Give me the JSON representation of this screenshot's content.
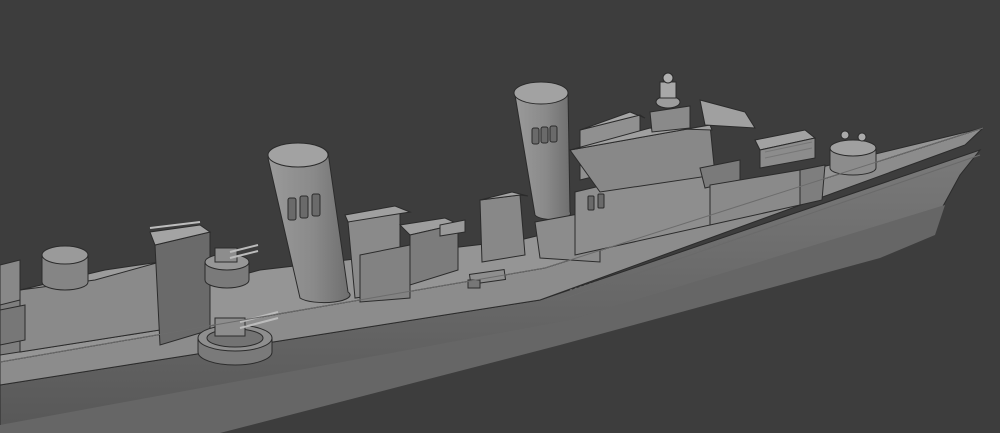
{
  "scene": {
    "background_color": "#3d3d3d",
    "model_color": "#8a8a8a",
    "shadow_color": "#5f5f5f",
    "highlight_color": "#a8a8a8",
    "edge_color": "#2b2b2b"
  }
}
